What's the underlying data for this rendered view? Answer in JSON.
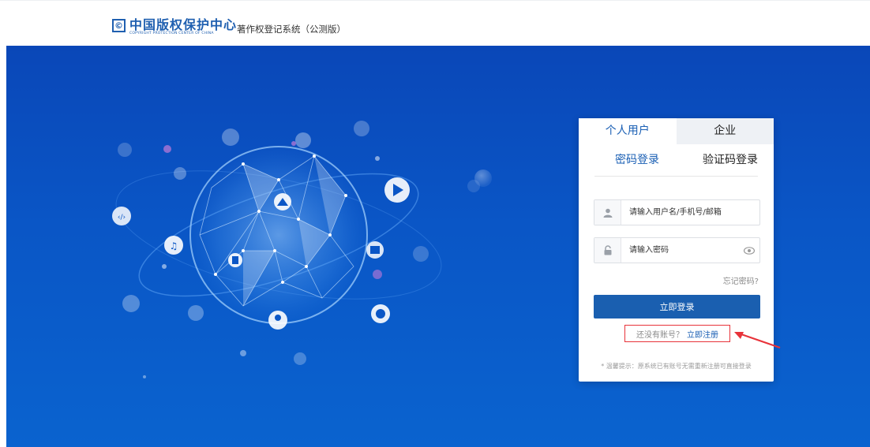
{
  "header": {
    "logo_mark": "©",
    "logo_cn": "中国版权保护中心",
    "logo_en": "COPYRIGHT PROTECTION CENTER OF CHINA",
    "system_title": "著作权登记系统（公测版）"
  },
  "login": {
    "tabs": [
      "个人用户",
      "企业"
    ],
    "subtabs": [
      "密码登录",
      "验证码登录"
    ],
    "username_placeholder": "请输入用户名/手机号/邮箱",
    "password_placeholder": "请输入密码",
    "forgot": "忘记密码?",
    "submit": "立即登录",
    "no_account": "还没有账号？",
    "register": "立即注册",
    "tip": "* 温馨提示：原系统已有账号无需重新注册可直接登录"
  },
  "colors": {
    "brand": "#1f5fb0",
    "accent": "#1a5fb4",
    "highlight": "#e8333a",
    "hero": "#0a56c6"
  }
}
